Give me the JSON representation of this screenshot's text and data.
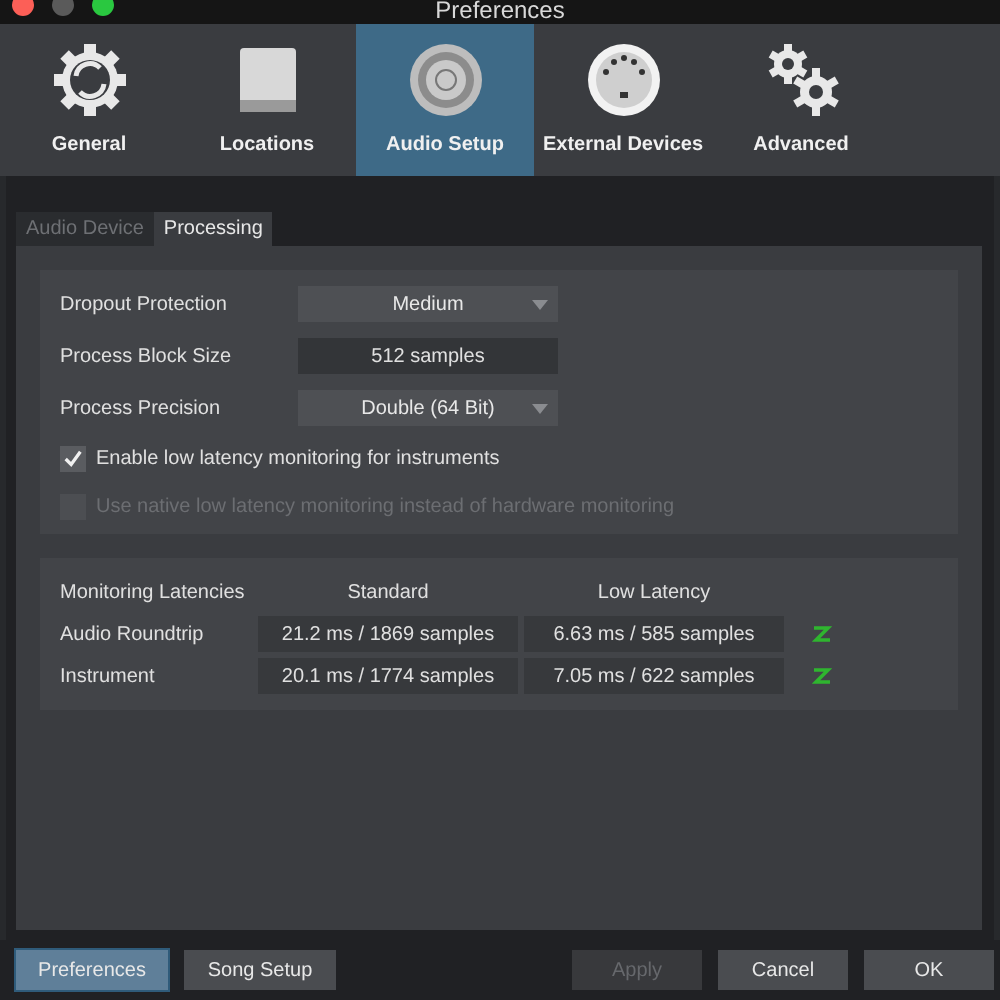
{
  "window": {
    "title": "Preferences"
  },
  "toolbar": [
    {
      "label": "General",
      "selected": false
    },
    {
      "label": "Locations",
      "selected": false
    },
    {
      "label": "Audio Setup",
      "selected": true
    },
    {
      "label": "External Devices",
      "selected": false
    },
    {
      "label": "Advanced",
      "selected": false
    }
  ],
  "subtabs": [
    {
      "label": "Audio Device",
      "selected": false
    },
    {
      "label": "Processing",
      "selected": true
    }
  ],
  "settings": [
    {
      "label": "Dropout Protection",
      "kind": "dropdown",
      "value": "Medium"
    },
    {
      "label": "Process Block Size",
      "kind": "readout",
      "value": "512 samples"
    },
    {
      "label": "Process Precision",
      "kind": "dropdown",
      "value": "Double (64 Bit)"
    }
  ],
  "options": [
    {
      "label": "Enable low latency monitoring for instruments",
      "checked": true,
      "disabled": false
    },
    {
      "label": "Use native low latency monitoring instead of hardware monitoring",
      "checked": false,
      "disabled": true
    }
  ],
  "latencies": {
    "columns": [
      "Monitoring Latencies",
      "Standard",
      "Low Latency"
    ],
    "rows": [
      {
        "name": "Audio Roundtrip",
        "standard": "21.2 ms / 1869 samples",
        "low": "6.63 ms / 585 samples"
      },
      {
        "name": "Instrument",
        "standard": "20.1 ms / 1774 samples",
        "low": "7.05 ms / 622 samples"
      }
    ]
  },
  "footer_left": [
    {
      "label": "Preferences",
      "selected": true,
      "disabled": false
    },
    {
      "label": "Song Setup",
      "selected": false,
      "disabled": false
    }
  ],
  "footer_right": [
    {
      "label": "Apply",
      "selected": false,
      "disabled": true
    },
    {
      "label": "Cancel",
      "selected": false,
      "disabled": false
    },
    {
      "label": "OK",
      "selected": false,
      "disabled": false
    }
  ]
}
